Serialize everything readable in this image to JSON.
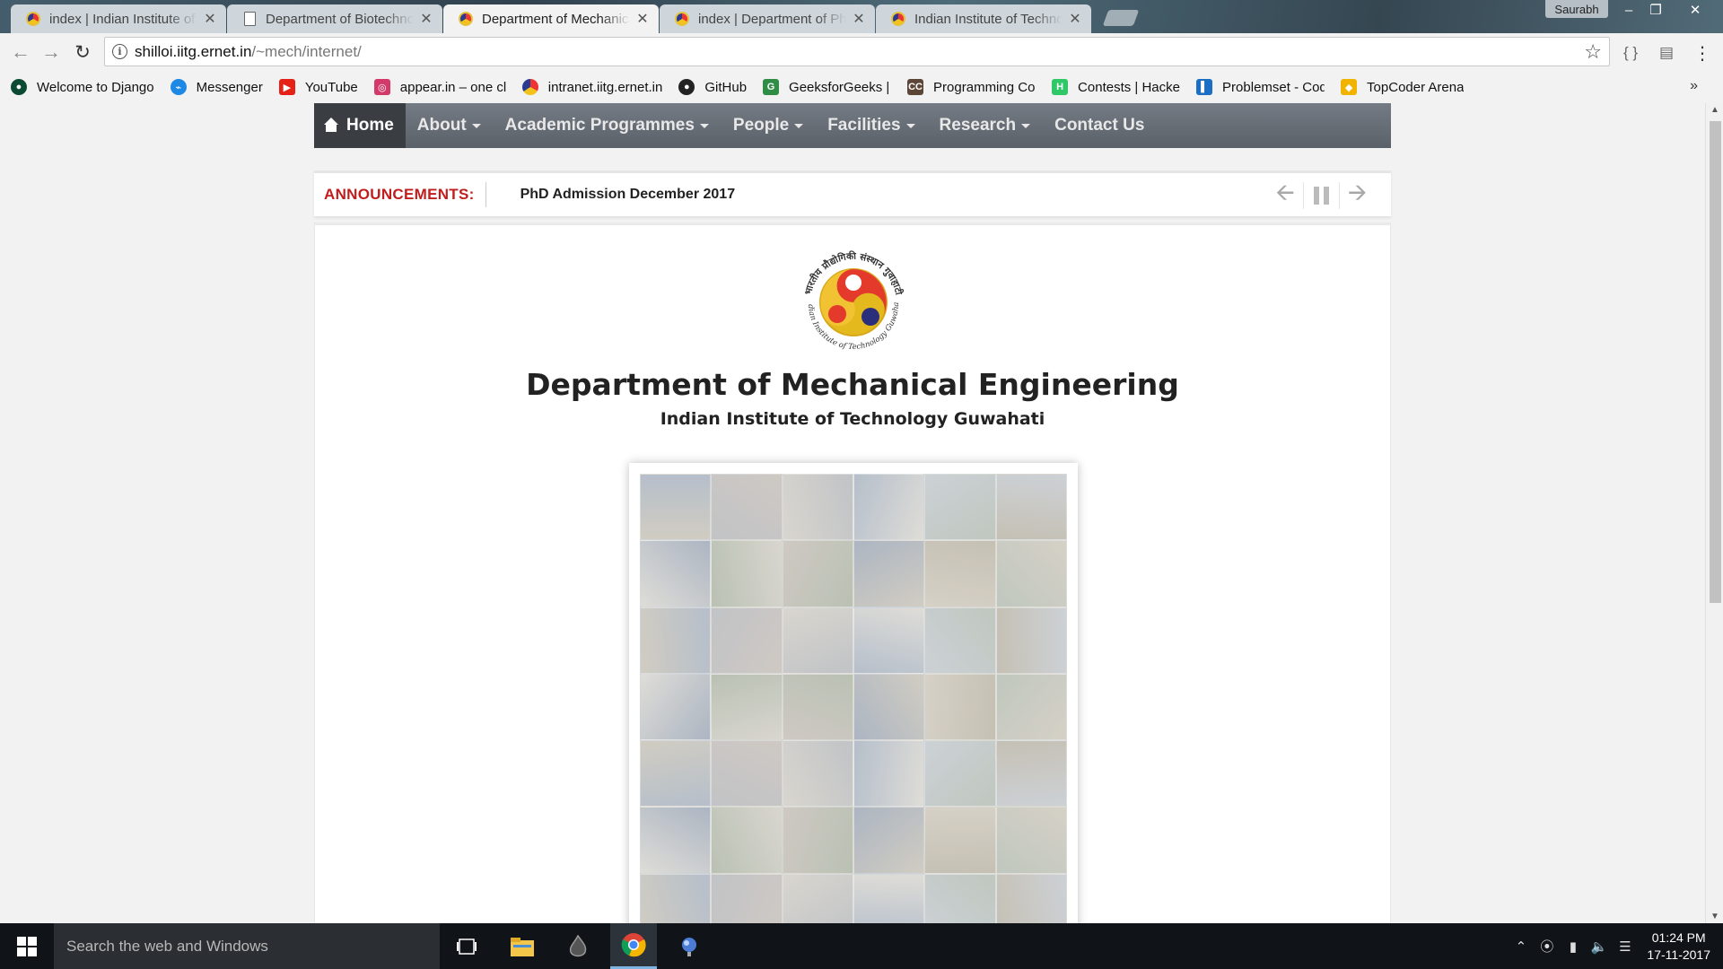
{
  "browser": {
    "tabs": [
      {
        "title": "index | Indian Institute of Technology Guwahati",
        "icon": "iitg-seal-icon",
        "active": false
      },
      {
        "title": "Department of Biotechnology",
        "icon": "document-icon",
        "active": false
      },
      {
        "title": "Department of Mechanical Engineering",
        "icon": "iitg-seal-icon",
        "active": true
      },
      {
        "title": "index | Department of Physics",
        "icon": "iitg-seal-icon",
        "active": false
      },
      {
        "title": "Indian Institute of Technology",
        "icon": "iitg-seal-icon",
        "active": false
      }
    ],
    "profile_name": "Saurabh",
    "url_host": "shilloi.iitg.ernet.in",
    "url_path": "/~mech/internet/",
    "bookmarks": [
      {
        "label": "Welcome to Django",
        "icon": "django-icon",
        "color": "#0c4b33"
      },
      {
        "label": "Messenger",
        "icon": "messenger-icon",
        "color": "#1e88e5"
      },
      {
        "label": "YouTube",
        "icon": "youtube-icon",
        "color": "#e62117"
      },
      {
        "label": "appear.in – one click",
        "icon": "appearin-icon",
        "color": "#d33a6a"
      },
      {
        "label": "intranet.iitg.ernet.in",
        "icon": "iitg-seal-icon",
        "color": "#e8a03a"
      },
      {
        "label": "GitHub",
        "icon": "github-icon",
        "color": "#222222"
      },
      {
        "label": "GeeksforGeeks | A co",
        "icon": "geeksforgeeks-icon",
        "color": "#2f8d46"
      },
      {
        "label": "Programming Compe",
        "icon": "codechef-icon",
        "color": "#5b4638"
      },
      {
        "label": "Contests | HackerRan",
        "icon": "hackerrank-icon",
        "color": "#2ec866"
      },
      {
        "label": "Problemset - Codefor",
        "icon": "codeforces-icon",
        "color": "#1a6fc4"
      },
      {
        "label": "TopCoder Arena",
        "icon": "topcoder-icon",
        "color": "#f0b400"
      }
    ]
  },
  "site": {
    "nav": {
      "home": "Home",
      "items": [
        {
          "label": "About",
          "dropdown": true
        },
        {
          "label": "Academic Programmes",
          "dropdown": true
        },
        {
          "label": "People",
          "dropdown": true
        },
        {
          "label": "Facilities",
          "dropdown": true
        },
        {
          "label": "Research",
          "dropdown": true
        },
        {
          "label": "Contact Us",
          "dropdown": false
        }
      ]
    },
    "announcements": {
      "label": "ANNOUNCEMENTS:",
      "current": "PhD Admission December 2017"
    },
    "logo_ring_text": "भारतीय प्रौद्योगिकी संस्थान गुवाहाटी",
    "logo_bottom_text": "Indian Institute of Technology Guwahati",
    "dept_title": "Department of Mechanical Engineering",
    "institute": "Indian Institute of Technology Guwahati"
  },
  "taskbar": {
    "search_placeholder": "Search the web and Windows",
    "time": "01:24 PM",
    "date": "17-11-2017"
  }
}
